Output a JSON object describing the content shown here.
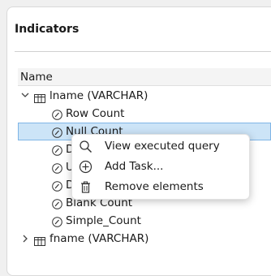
{
  "panel": {
    "title": "Indicators"
  },
  "tree": {
    "column_header": "Name",
    "rows": [
      {
        "label": "lname (VARCHAR)",
        "kind": "table",
        "expanded": true
      },
      {
        "label": "Row Count",
        "kind": "indicator"
      },
      {
        "label": "Null Count",
        "kind": "indicator",
        "selected": true
      },
      {
        "label": "D",
        "kind": "indicator"
      },
      {
        "label": "U",
        "kind": "indicator"
      },
      {
        "label": "D",
        "kind": "indicator"
      },
      {
        "label": "Blank Count",
        "kind": "indicator"
      },
      {
        "label": "Simple_Count",
        "kind": "indicator"
      },
      {
        "label": "fname (VARCHAR)",
        "kind": "table",
        "expanded": false
      }
    ]
  },
  "context_menu": {
    "items": [
      {
        "label": "View executed query",
        "icon": "search-icon"
      },
      {
        "label": "Add Task...",
        "icon": "add-circle-icon"
      },
      {
        "label": "Remove elements",
        "icon": "trash-icon"
      }
    ]
  },
  "colors": {
    "selection": "#cce4f7",
    "selection_border": "#7fb5e6"
  }
}
